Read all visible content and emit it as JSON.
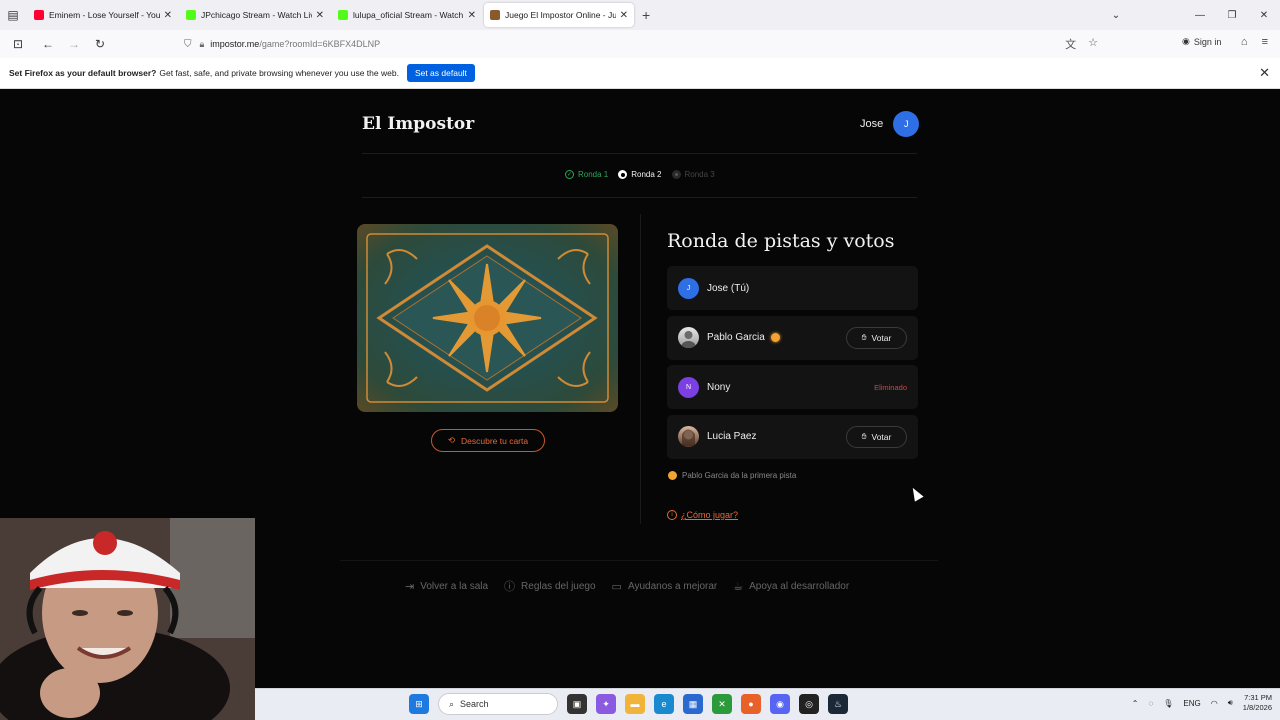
{
  "browser": {
    "tabs": [
      {
        "title": "Eminem - Lose Yourself - YouTube",
        "favicon_color": "#ff0033",
        "active": false
      },
      {
        "title": "JPchicago Stream - Watch Live o",
        "favicon_color": "#53fc18",
        "active": false
      },
      {
        "title": "lulupa_oficial Stream - Watch Li",
        "favicon_color": "#53fc18",
        "active": false
      },
      {
        "title": "Juego El Impostor Online - Jugar",
        "favicon_color": "#8a5a2a",
        "active": true
      }
    ],
    "url_host": "impostor.me",
    "url_path": "/game?roomId=6KBFX4DLNP",
    "sign_in": "Sign in",
    "infobar": {
      "bold": "Set Firefox as your default browser?",
      "text": "Get fast, safe, and private browsing whenever you use the web.",
      "button": "Set as default"
    }
  },
  "app": {
    "brand": "El Impostor",
    "user": {
      "name": "Jose",
      "initial": "J"
    },
    "rounds": [
      {
        "label": "Ronda 1",
        "state": "done"
      },
      {
        "label": "Ronda 2",
        "state": "current"
      },
      {
        "label": "Ronda 3",
        "state": "pending"
      }
    ],
    "discover_button": "Descubre tu carta",
    "heading": "Ronda de pistas y votos",
    "players": [
      {
        "name": "Jose (Tú)",
        "initial": "J",
        "avatar_color": "#2f6fe6"
      },
      {
        "name": "Pablo Garcia",
        "avatar_color": "#bfbfbf",
        "vote_label": "Votar"
      },
      {
        "name": "Nony",
        "initial": "N",
        "avatar_color": "#7b3fe4",
        "status": "Eliminado"
      },
      {
        "name": "Lucia Paez",
        "avatar_color": "#8a6a5a",
        "vote_label": "Votar"
      }
    ],
    "hint": "Pablo Garcia da la primera pista",
    "how_to": "¿Cómo jugar?",
    "footer": [
      {
        "label": "Volver a la sala",
        "icon": "exit-icon"
      },
      {
        "label": "Reglas del juego",
        "icon": "info-icon"
      },
      {
        "label": "Ayudanos a mejorar",
        "icon": "message-icon"
      },
      {
        "label": "Apoya al desarrollador",
        "icon": "coffee-icon"
      }
    ]
  },
  "taskbar": {
    "search_placeholder": "Search",
    "language": "ENG",
    "time": "7:31 PM",
    "date": "1/8/2026"
  },
  "colors": {
    "accent": "#e66a3a",
    "success": "#2fa55a",
    "danger": "#d2453e",
    "blue": "#2f6fe6"
  }
}
